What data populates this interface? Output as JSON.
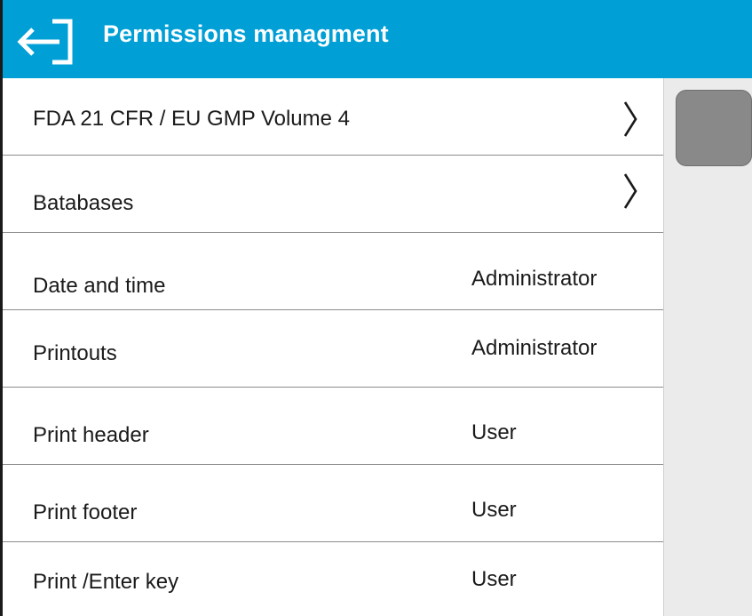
{
  "header": {
    "title": "Permissions managment",
    "back_icon": "exit-arrow-icon"
  },
  "list": {
    "items": [
      {
        "label": "FDA 21 CFR / EU GMP Volume 4",
        "value": "",
        "icon": "chevron-right-icon"
      },
      {
        "label": "Batabases",
        "value": "",
        "icon": "chevron-right-icon"
      },
      {
        "label": "Date and time",
        "value": "Administrator"
      },
      {
        "label": "Printouts",
        "value": "Administrator"
      },
      {
        "label": "Print header",
        "value": "User"
      },
      {
        "label": "Print footer",
        "value": "User"
      },
      {
        "label": "Print /Enter key",
        "value": "User"
      }
    ]
  },
  "colors": {
    "header_bg": "#009fd6",
    "header_text": "#ffffff",
    "row_text": "#1a1a1a",
    "divider": "#8c8c8c",
    "scrollbar_track": "#ebebeb",
    "scrollbar_thumb": "#898989"
  }
}
